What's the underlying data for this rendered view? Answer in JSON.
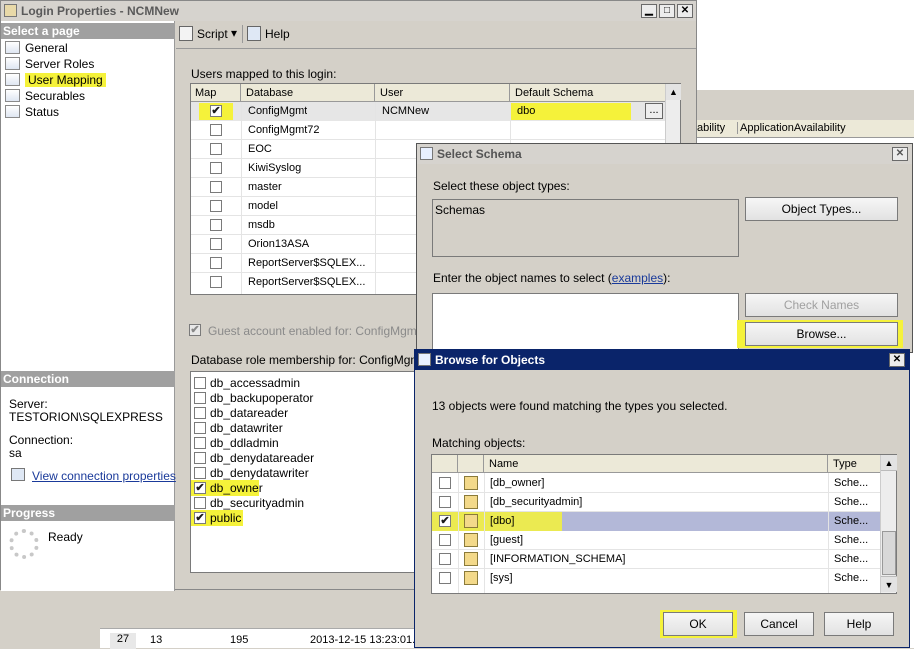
{
  "window": {
    "title": "Login Properties - NCMNew"
  },
  "sidebar": {
    "section_title": "Select a page",
    "items": [
      "General",
      "Server Roles",
      "User Mapping",
      "Securables",
      "Status"
    ],
    "connection_title": "Connection",
    "server_label": "Server:",
    "server_value": "TESTORION\\SQLEXPRESS",
    "connection_label": "Connection:",
    "connection_value": "sa",
    "view_link": "View connection properties",
    "progress_title": "Progress",
    "progress_status": "Ready"
  },
  "toolbar": {
    "script_label": "Script",
    "help_label": "Help"
  },
  "mapping": {
    "section_label": "Users mapped to this login:",
    "columns": [
      "Map",
      "Database",
      "User",
      "Default Schema"
    ],
    "rows": [
      {
        "checked": true,
        "database": "ConfigMgmt",
        "user": "NCMNew",
        "schema": "dbo"
      },
      {
        "checked": false,
        "database": "ConfigMgmt72",
        "user": "",
        "schema": ""
      },
      {
        "checked": false,
        "database": "EOC",
        "user": "",
        "schema": ""
      },
      {
        "checked": false,
        "database": "KiwiSyslog",
        "user": "",
        "schema": ""
      },
      {
        "checked": false,
        "database": "master",
        "user": "",
        "schema": ""
      },
      {
        "checked": false,
        "database": "model",
        "user": "",
        "schema": ""
      },
      {
        "checked": false,
        "database": "msdb",
        "user": "",
        "schema": ""
      },
      {
        "checked": false,
        "database": "Orion13ASA",
        "user": "",
        "schema": ""
      },
      {
        "checked": false,
        "database": "ReportServer$SQLEX...",
        "user": "",
        "schema": ""
      },
      {
        "checked": false,
        "database": "ReportServer$SQLEX...",
        "user": "",
        "schema": ""
      }
    ],
    "ellipsis": "...",
    "guest_label": "Guest account enabled for: ConfigMgmt",
    "role_label": "Database role membership for: ConfigMgmt",
    "roles": [
      {
        "name": "db_accessadmin",
        "checked": false
      },
      {
        "name": "db_backupoperator",
        "checked": false
      },
      {
        "name": "db_datareader",
        "checked": false
      },
      {
        "name": "db_datawriter",
        "checked": false
      },
      {
        "name": "db_ddladmin",
        "checked": false
      },
      {
        "name": "db_denydatareader",
        "checked": false
      },
      {
        "name": "db_denydatawriter",
        "checked": false
      },
      {
        "name": "db_owner",
        "checked": true
      },
      {
        "name": "db_securityadmin",
        "checked": false
      },
      {
        "name": "public",
        "checked": true
      }
    ]
  },
  "background": {
    "col1": "ability",
    "col2": "ApplicationAvailability",
    "row_cells": [
      "27",
      "13",
      "195",
      "2013-12-15 13:23:01."
    ]
  },
  "select_schema": {
    "title": "Select Schema",
    "object_types_label": "Select these object types:",
    "object_types_value": "Schemas",
    "object_types_button": "Object Types...",
    "names_label_prefix": "Enter the object names to select (",
    "names_link": "examples",
    "names_label_suffix": "):",
    "check_names_button": "Check Names",
    "browse_button": "Browse..."
  },
  "browse": {
    "title": "Browse for Objects",
    "found_text": "13 objects were found matching the types you selected.",
    "matching_label": "Matching objects:",
    "columns": [
      "Name",
      "Type"
    ],
    "rows": [
      {
        "checked": false,
        "name": "[db_owner]",
        "type": "Sche..."
      },
      {
        "checked": false,
        "name": "[db_securityadmin]",
        "type": "Sche..."
      },
      {
        "checked": true,
        "name": "[dbo]",
        "type": "Sche..."
      },
      {
        "checked": false,
        "name": "[guest]",
        "type": "Sche..."
      },
      {
        "checked": false,
        "name": "[INFORMATION_SCHEMA]",
        "type": "Sche..."
      },
      {
        "checked": false,
        "name": "[sys]",
        "type": "Sche..."
      }
    ],
    "ok": "OK",
    "cancel": "Cancel",
    "help": "Help"
  },
  "glyphs": {
    "check": "✔",
    "up": "▲",
    "down": "▼",
    "close": "✕",
    "min": "▁",
    "max": "□",
    "dropdown": "▾"
  },
  "colors": {
    "title_active": "#0a246a",
    "highlight": "#f5f23a",
    "selected_row": "#b3b8d8"
  }
}
